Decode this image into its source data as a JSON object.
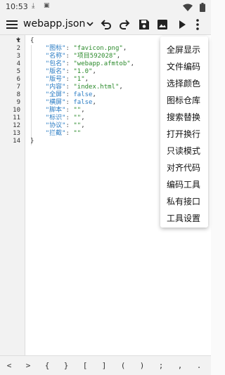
{
  "status": {
    "time": "10:53",
    "icon1": "download-icon",
    "icon2": "notification-icon",
    "wifi": "wifi-icon",
    "battery": "battery-icon"
  },
  "toolbar": {
    "menu_icon": "hamburger-icon",
    "file_name": "webapp.json",
    "file_dropdown_icon": "chevron-down-icon",
    "undo_icon": "undo-icon",
    "redo_icon": "redo-icon",
    "save_icon": "save-icon",
    "image_icon": "image-icon",
    "run_icon": "play-icon",
    "more_icon": "more-vert-icon"
  },
  "editor": {
    "line_numbers": [
      "1",
      "2",
      "3",
      "4",
      "5",
      "6",
      "7",
      "8",
      "9",
      "10",
      "11",
      "12",
      "13",
      "14"
    ],
    "lines": [
      "{",
      "    \"图标\": \"favicon.png\",",
      "    \"名称\": \"项目592028\",",
      "    \"包名\": \"webapp.afmtob\",",
      "    \"版名\": \"1.0\",",
      "    \"版号\": \"1\",",
      "    \"内容\": \"index.html\",",
      "    \"全屏\": false,",
      "    \"横屏\": false,",
      "    \"脚本\": \"\",",
      "    \"标识\": \"\",",
      "    \"协议\": \"\",",
      "    \"拦截\": \"\"",
      "}"
    ]
  },
  "menu": {
    "items": [
      "全屏显示",
      "文件编码",
      "选择颜色",
      "图标仓库",
      "搜索替换",
      "打开换行",
      "只读模式",
      "对齐代码",
      "编码工具",
      "私有接口",
      "工具设置"
    ]
  },
  "bottom_bar": {
    "symbols": [
      "<",
      ">",
      "{",
      "}",
      "[",
      "]",
      "(",
      ")",
      ";",
      ",",
      "."
    ]
  }
}
